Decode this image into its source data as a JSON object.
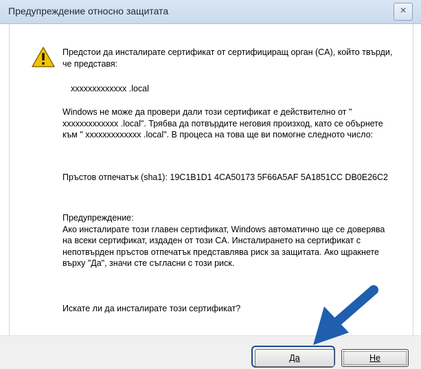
{
  "window": {
    "title": "Предупреждение относно защитата",
    "close_symbol": "×"
  },
  "message": {
    "intro": "Предстои да инсталирате сертификат от сертифициращ орган (CA), който твърди, че представя:",
    "host": "xxxxxxxxxxxxx .local",
    "verify": "Windows не може да провери дали този сертификат е действително от \" xxxxxxxxxxxxx .local\". Трябва да потвърдите неговия произход, като се обърнете към \" xxxxxxxxxxxxx .local\". В процеса на това ще ви помогне следното число:",
    "thumbprint": "Пръстов отпечатък (sha1): 19C1B1D1 4CA50173 5F66A5AF 5A1851CC DB0E26C2",
    "warning_title": "Предупреждение:",
    "warning_body": "Ако инсталирате този главен сертификат, Windows автоматично ще се доверява на всеки сертификат, издаден от този CA. Инсталирането на сертификат с непотвърден пръстов отпечатък представлява риск за защитата. Ако щракнете върху \"Да\", значи сте съгласни с този риск.",
    "question": "Искате ли да инсталирате този сертификат?"
  },
  "buttons": {
    "yes_label": "Да",
    "no_label": "Не"
  },
  "icons": {
    "warning": "warning-icon",
    "arrow": "arrow-icon"
  },
  "colors": {
    "arrow": "#1f5fae",
    "warning_fill": "#f5c400"
  }
}
